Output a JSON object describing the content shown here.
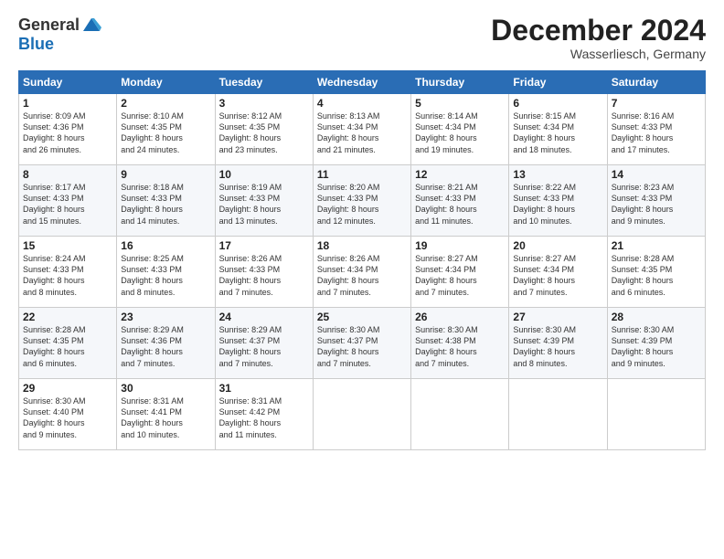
{
  "header": {
    "logo_line1": "General",
    "logo_line2": "Blue",
    "month": "December 2024",
    "location": "Wasserliesch, Germany"
  },
  "days_of_week": [
    "Sunday",
    "Monday",
    "Tuesday",
    "Wednesday",
    "Thursday",
    "Friday",
    "Saturday"
  ],
  "weeks": [
    [
      {
        "day": "1",
        "info": "Sunrise: 8:09 AM\nSunset: 4:36 PM\nDaylight: 8 hours\nand 26 minutes."
      },
      {
        "day": "2",
        "info": "Sunrise: 8:10 AM\nSunset: 4:35 PM\nDaylight: 8 hours\nand 24 minutes."
      },
      {
        "day": "3",
        "info": "Sunrise: 8:12 AM\nSunset: 4:35 PM\nDaylight: 8 hours\nand 23 minutes."
      },
      {
        "day": "4",
        "info": "Sunrise: 8:13 AM\nSunset: 4:34 PM\nDaylight: 8 hours\nand 21 minutes."
      },
      {
        "day": "5",
        "info": "Sunrise: 8:14 AM\nSunset: 4:34 PM\nDaylight: 8 hours\nand 19 minutes."
      },
      {
        "day": "6",
        "info": "Sunrise: 8:15 AM\nSunset: 4:34 PM\nDaylight: 8 hours\nand 18 minutes."
      },
      {
        "day": "7",
        "info": "Sunrise: 8:16 AM\nSunset: 4:33 PM\nDaylight: 8 hours\nand 17 minutes."
      }
    ],
    [
      {
        "day": "8",
        "info": "Sunrise: 8:17 AM\nSunset: 4:33 PM\nDaylight: 8 hours\nand 15 minutes."
      },
      {
        "day": "9",
        "info": "Sunrise: 8:18 AM\nSunset: 4:33 PM\nDaylight: 8 hours\nand 14 minutes."
      },
      {
        "day": "10",
        "info": "Sunrise: 8:19 AM\nSunset: 4:33 PM\nDaylight: 8 hours\nand 13 minutes."
      },
      {
        "day": "11",
        "info": "Sunrise: 8:20 AM\nSunset: 4:33 PM\nDaylight: 8 hours\nand 12 minutes."
      },
      {
        "day": "12",
        "info": "Sunrise: 8:21 AM\nSunset: 4:33 PM\nDaylight: 8 hours\nand 11 minutes."
      },
      {
        "day": "13",
        "info": "Sunrise: 8:22 AM\nSunset: 4:33 PM\nDaylight: 8 hours\nand 10 minutes."
      },
      {
        "day": "14",
        "info": "Sunrise: 8:23 AM\nSunset: 4:33 PM\nDaylight: 8 hours\nand 9 minutes."
      }
    ],
    [
      {
        "day": "15",
        "info": "Sunrise: 8:24 AM\nSunset: 4:33 PM\nDaylight: 8 hours\nand 8 minutes."
      },
      {
        "day": "16",
        "info": "Sunrise: 8:25 AM\nSunset: 4:33 PM\nDaylight: 8 hours\nand 8 minutes."
      },
      {
        "day": "17",
        "info": "Sunrise: 8:26 AM\nSunset: 4:33 PM\nDaylight: 8 hours\nand 7 minutes."
      },
      {
        "day": "18",
        "info": "Sunrise: 8:26 AM\nSunset: 4:34 PM\nDaylight: 8 hours\nand 7 minutes."
      },
      {
        "day": "19",
        "info": "Sunrise: 8:27 AM\nSunset: 4:34 PM\nDaylight: 8 hours\nand 7 minutes."
      },
      {
        "day": "20",
        "info": "Sunrise: 8:27 AM\nSunset: 4:34 PM\nDaylight: 8 hours\nand 7 minutes."
      },
      {
        "day": "21",
        "info": "Sunrise: 8:28 AM\nSunset: 4:35 PM\nDaylight: 8 hours\nand 6 minutes."
      }
    ],
    [
      {
        "day": "22",
        "info": "Sunrise: 8:28 AM\nSunset: 4:35 PM\nDaylight: 8 hours\nand 6 minutes."
      },
      {
        "day": "23",
        "info": "Sunrise: 8:29 AM\nSunset: 4:36 PM\nDaylight: 8 hours\nand 7 minutes."
      },
      {
        "day": "24",
        "info": "Sunrise: 8:29 AM\nSunset: 4:37 PM\nDaylight: 8 hours\nand 7 minutes."
      },
      {
        "day": "25",
        "info": "Sunrise: 8:30 AM\nSunset: 4:37 PM\nDaylight: 8 hours\nand 7 minutes."
      },
      {
        "day": "26",
        "info": "Sunrise: 8:30 AM\nSunset: 4:38 PM\nDaylight: 8 hours\nand 7 minutes."
      },
      {
        "day": "27",
        "info": "Sunrise: 8:30 AM\nSunset: 4:39 PM\nDaylight: 8 hours\nand 8 minutes."
      },
      {
        "day": "28",
        "info": "Sunrise: 8:30 AM\nSunset: 4:39 PM\nDaylight: 8 hours\nand 9 minutes."
      }
    ],
    [
      {
        "day": "29",
        "info": "Sunrise: 8:30 AM\nSunset: 4:40 PM\nDaylight: 8 hours\nand 9 minutes."
      },
      {
        "day": "30",
        "info": "Sunrise: 8:31 AM\nSunset: 4:41 PM\nDaylight: 8 hours\nand 10 minutes."
      },
      {
        "day": "31",
        "info": "Sunrise: 8:31 AM\nSunset: 4:42 PM\nDaylight: 8 hours\nand 11 minutes."
      },
      null,
      null,
      null,
      null
    ]
  ]
}
